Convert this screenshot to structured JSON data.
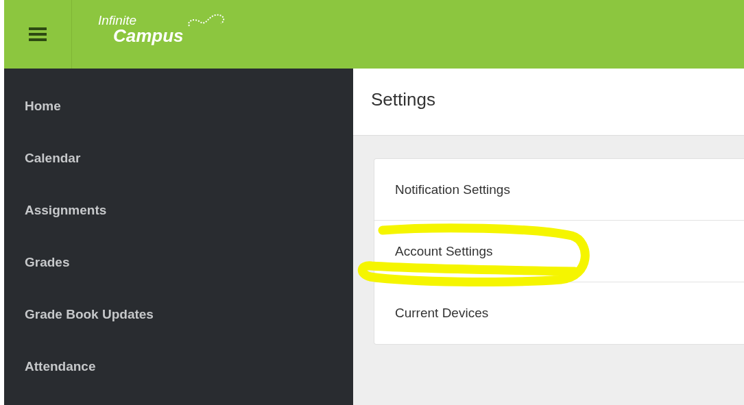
{
  "header": {
    "logo": {
      "line1": "Infinite",
      "line2": "Campus"
    }
  },
  "sidebar": {
    "items": [
      {
        "label": "Home"
      },
      {
        "label": "Calendar"
      },
      {
        "label": "Assignments"
      },
      {
        "label": "Grades"
      },
      {
        "label": "Grade Book Updates"
      },
      {
        "label": "Attendance"
      }
    ]
  },
  "page": {
    "title": "Settings"
  },
  "settings": [
    {
      "label": "Notification Settings",
      "highlighted": false
    },
    {
      "label": "Account Settings",
      "highlighted": true
    },
    {
      "label": "Current Devices",
      "highlighted": false
    }
  ]
}
